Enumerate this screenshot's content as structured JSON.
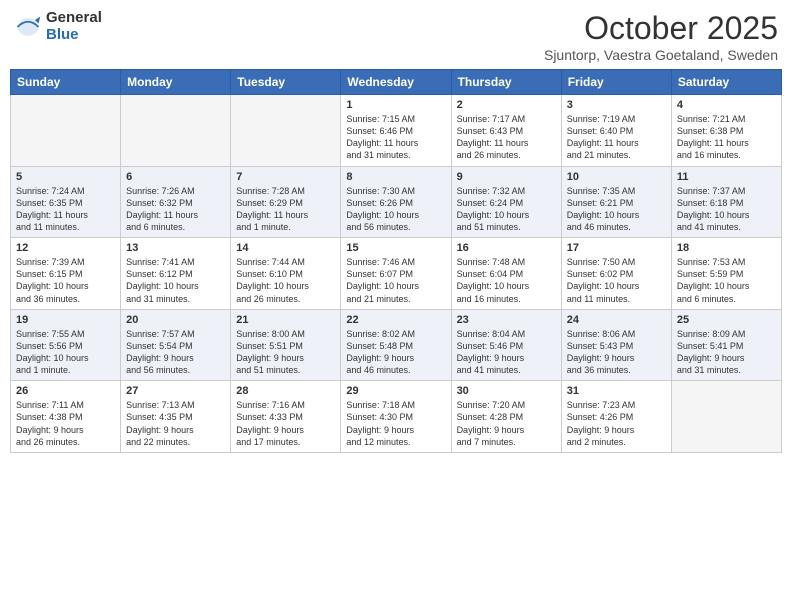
{
  "header": {
    "logo": {
      "general": "General",
      "blue": "Blue"
    },
    "title": "October 2025",
    "location": "Sjuntorp, Vaestra Goetaland, Sweden"
  },
  "calendar": {
    "weekdays": [
      "Sunday",
      "Monday",
      "Tuesday",
      "Wednesday",
      "Thursday",
      "Friday",
      "Saturday"
    ],
    "weeks": [
      [
        {
          "day": "",
          "info": ""
        },
        {
          "day": "",
          "info": ""
        },
        {
          "day": "",
          "info": ""
        },
        {
          "day": "1",
          "info": "Sunrise: 7:15 AM\nSunset: 6:46 PM\nDaylight: 11 hours\nand 31 minutes."
        },
        {
          "day": "2",
          "info": "Sunrise: 7:17 AM\nSunset: 6:43 PM\nDaylight: 11 hours\nand 26 minutes."
        },
        {
          "day": "3",
          "info": "Sunrise: 7:19 AM\nSunset: 6:40 PM\nDaylight: 11 hours\nand 21 minutes."
        },
        {
          "day": "4",
          "info": "Sunrise: 7:21 AM\nSunset: 6:38 PM\nDaylight: 11 hours\nand 16 minutes."
        }
      ],
      [
        {
          "day": "5",
          "info": "Sunrise: 7:24 AM\nSunset: 6:35 PM\nDaylight: 11 hours\nand 11 minutes."
        },
        {
          "day": "6",
          "info": "Sunrise: 7:26 AM\nSunset: 6:32 PM\nDaylight: 11 hours\nand 6 minutes."
        },
        {
          "day": "7",
          "info": "Sunrise: 7:28 AM\nSunset: 6:29 PM\nDaylight: 11 hours\nand 1 minute."
        },
        {
          "day": "8",
          "info": "Sunrise: 7:30 AM\nSunset: 6:26 PM\nDaylight: 10 hours\nand 56 minutes."
        },
        {
          "day": "9",
          "info": "Sunrise: 7:32 AM\nSunset: 6:24 PM\nDaylight: 10 hours\nand 51 minutes."
        },
        {
          "day": "10",
          "info": "Sunrise: 7:35 AM\nSunset: 6:21 PM\nDaylight: 10 hours\nand 46 minutes."
        },
        {
          "day": "11",
          "info": "Sunrise: 7:37 AM\nSunset: 6:18 PM\nDaylight: 10 hours\nand 41 minutes."
        }
      ],
      [
        {
          "day": "12",
          "info": "Sunrise: 7:39 AM\nSunset: 6:15 PM\nDaylight: 10 hours\nand 36 minutes."
        },
        {
          "day": "13",
          "info": "Sunrise: 7:41 AM\nSunset: 6:12 PM\nDaylight: 10 hours\nand 31 minutes."
        },
        {
          "day": "14",
          "info": "Sunrise: 7:44 AM\nSunset: 6:10 PM\nDaylight: 10 hours\nand 26 minutes."
        },
        {
          "day": "15",
          "info": "Sunrise: 7:46 AM\nSunset: 6:07 PM\nDaylight: 10 hours\nand 21 minutes."
        },
        {
          "day": "16",
          "info": "Sunrise: 7:48 AM\nSunset: 6:04 PM\nDaylight: 10 hours\nand 16 minutes."
        },
        {
          "day": "17",
          "info": "Sunrise: 7:50 AM\nSunset: 6:02 PM\nDaylight: 10 hours\nand 11 minutes."
        },
        {
          "day": "18",
          "info": "Sunrise: 7:53 AM\nSunset: 5:59 PM\nDaylight: 10 hours\nand 6 minutes."
        }
      ],
      [
        {
          "day": "19",
          "info": "Sunrise: 7:55 AM\nSunset: 5:56 PM\nDaylight: 10 hours\nand 1 minute."
        },
        {
          "day": "20",
          "info": "Sunrise: 7:57 AM\nSunset: 5:54 PM\nDaylight: 9 hours\nand 56 minutes."
        },
        {
          "day": "21",
          "info": "Sunrise: 8:00 AM\nSunset: 5:51 PM\nDaylight: 9 hours\nand 51 minutes."
        },
        {
          "day": "22",
          "info": "Sunrise: 8:02 AM\nSunset: 5:48 PM\nDaylight: 9 hours\nand 46 minutes."
        },
        {
          "day": "23",
          "info": "Sunrise: 8:04 AM\nSunset: 5:46 PM\nDaylight: 9 hours\nand 41 minutes."
        },
        {
          "day": "24",
          "info": "Sunrise: 8:06 AM\nSunset: 5:43 PM\nDaylight: 9 hours\nand 36 minutes."
        },
        {
          "day": "25",
          "info": "Sunrise: 8:09 AM\nSunset: 5:41 PM\nDaylight: 9 hours\nand 31 minutes."
        }
      ],
      [
        {
          "day": "26",
          "info": "Sunrise: 7:11 AM\nSunset: 4:38 PM\nDaylight: 9 hours\nand 26 minutes."
        },
        {
          "day": "27",
          "info": "Sunrise: 7:13 AM\nSunset: 4:35 PM\nDaylight: 9 hours\nand 22 minutes."
        },
        {
          "day": "28",
          "info": "Sunrise: 7:16 AM\nSunset: 4:33 PM\nDaylight: 9 hours\nand 17 minutes."
        },
        {
          "day": "29",
          "info": "Sunrise: 7:18 AM\nSunset: 4:30 PM\nDaylight: 9 hours\nand 12 minutes."
        },
        {
          "day": "30",
          "info": "Sunrise: 7:20 AM\nSunset: 4:28 PM\nDaylight: 9 hours\nand 7 minutes."
        },
        {
          "day": "31",
          "info": "Sunrise: 7:23 AM\nSunset: 4:26 PM\nDaylight: 9 hours\nand 2 minutes."
        },
        {
          "day": "",
          "info": ""
        }
      ]
    ]
  }
}
